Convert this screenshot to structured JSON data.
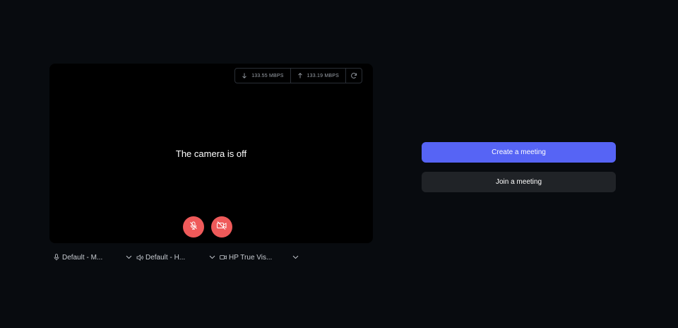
{
  "preview": {
    "camera_status": "The camera is off",
    "network": {
      "download_speed": "133.55 MBPS",
      "upload_speed": "133.19 MBPS"
    }
  },
  "devices": [
    {
      "label": "Default - M...",
      "icon": "microphone-icon"
    },
    {
      "label": "Default - H...",
      "icon": "speaker-icon"
    },
    {
      "label": "HP True Vis...",
      "icon": "video-camera-icon"
    }
  ],
  "actions": {
    "create_label": "Create a meeting",
    "join_label": "Join a meeting"
  },
  "colors": {
    "background": "#080b0f",
    "preview": "#000000",
    "primary": "#5664f5",
    "secondary": "#202327",
    "danger": "#ef5a5a"
  }
}
